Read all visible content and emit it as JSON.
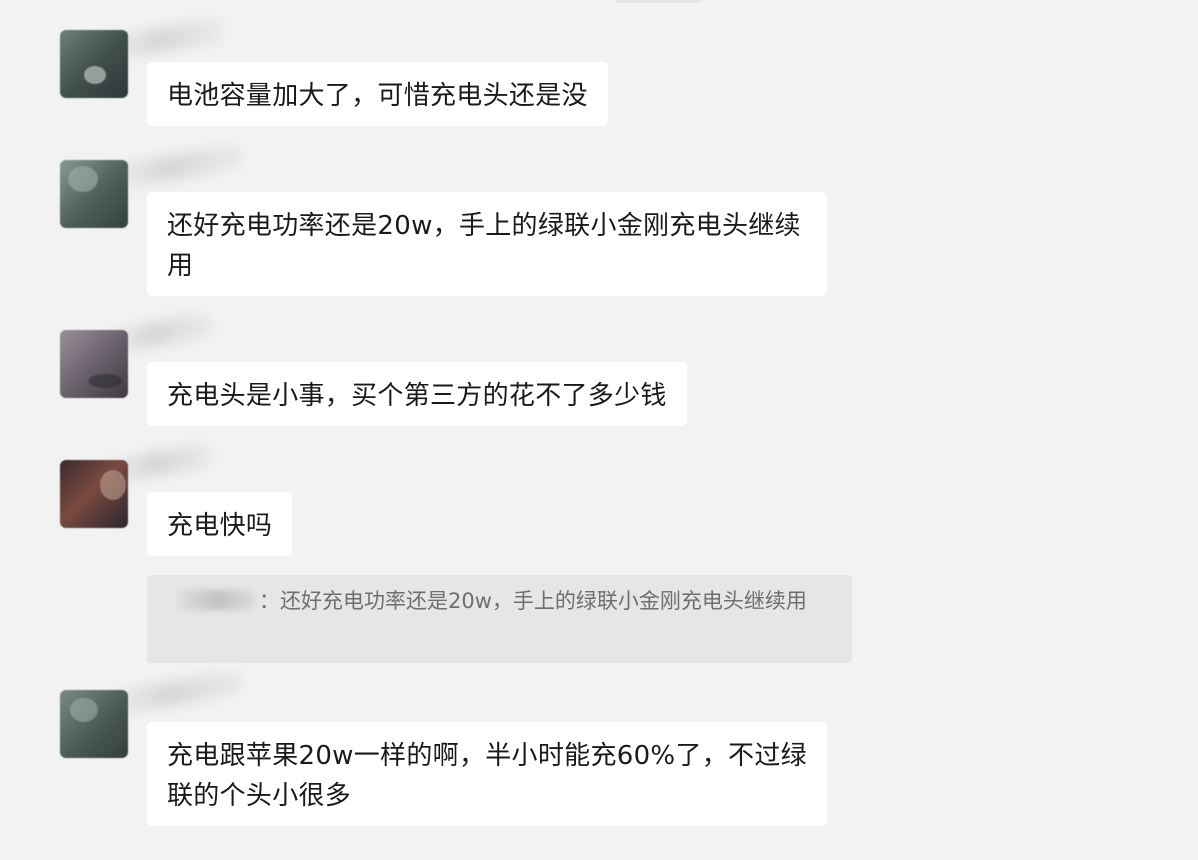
{
  "chat": {
    "messages": [
      {
        "text": "电池容量加大了，可惜充电头还是没"
      },
      {
        "text": "还好充电功率还是20w，手上的绿联小金刚充电头继续用"
      },
      {
        "text": "充电头是小事，买个第三方的花不了多少钱"
      },
      {
        "text": "充电快吗"
      },
      {
        "text": "充电跟苹果20w一样的啊，半小时能充60%了，不过绿联的个头小很多"
      }
    ],
    "quote": {
      "text": "：还好充电功率还是20w，手上的绿联小金刚充电头继续用"
    }
  },
  "colors": {
    "background": "#f2f2f2",
    "bubble": "#ffffff",
    "quote_background": "#e6e6e6",
    "text": "#1a1a1a",
    "quote_text": "#6f6f6f"
  }
}
